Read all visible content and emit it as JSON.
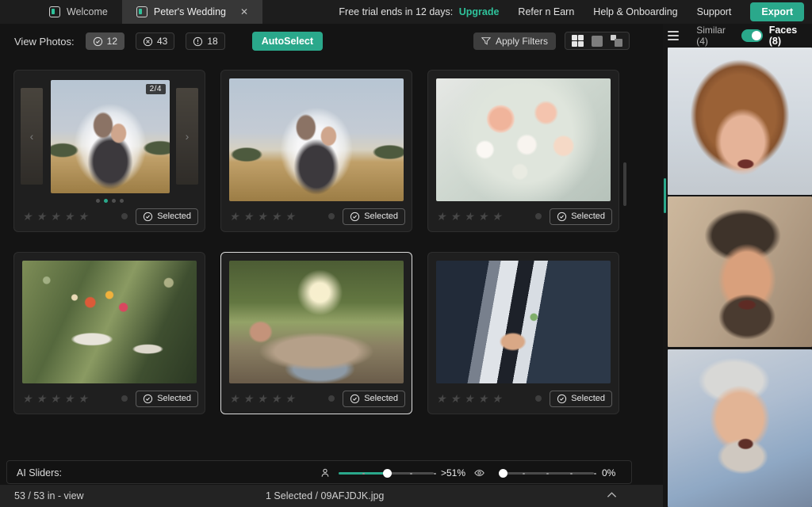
{
  "colors": {
    "accent": "#2aa88b",
    "accent_bright": "#2fc29b"
  },
  "tabbar": {
    "tabs": [
      {
        "label": "Welcome",
        "active": false
      },
      {
        "label": "Peter's Wedding",
        "active": true
      }
    ],
    "trial_text": "Free trial ends in 12 days:",
    "upgrade_label": "Upgrade",
    "links": [
      {
        "label": "Refer n Earn"
      },
      {
        "label": "Help & Onboarding"
      },
      {
        "label": "Support"
      }
    ],
    "export_label": "Export"
  },
  "toolbar": {
    "view_photos_label": "View Photos:",
    "filter_chips": [
      {
        "icon": "check-circle",
        "count": "12",
        "active": true
      },
      {
        "icon": "cross-circle",
        "count": "43",
        "active": false
      },
      {
        "icon": "alert-circle",
        "count": "18",
        "active": false
      }
    ],
    "autoselect_label": "AutoSelect",
    "apply_filters_label": "Apply Filters"
  },
  "grid": {
    "selected_label": "Selected",
    "cards": [
      {
        "photo": "veil-couple-carousel",
        "carousel_badge": "2/4",
        "dots_count": 4,
        "dots_active_index": 1,
        "stars": 0,
        "selected": true
      },
      {
        "photo": "veil-couple-wide",
        "stars": 0,
        "selected": true
      },
      {
        "photo": "rose-bouquet",
        "stars": 0,
        "selected": true
      },
      {
        "photo": "table-setting",
        "stars": 0,
        "selected": true
      },
      {
        "photo": "family-group",
        "focused": true,
        "stars": 0,
        "selected": true
      },
      {
        "photo": "groom-boutonniere",
        "stars": 0,
        "selected": true
      }
    ]
  },
  "sidebar": {
    "similar_label": "Similar (4)",
    "faces_label": "Faces (8)",
    "toggle_state": "faces",
    "faces": [
      {
        "desc": "laughing woman with auburn hair"
      },
      {
        "desc": "laughing bearded man"
      },
      {
        "desc": "laughing older man in blue shirt"
      }
    ]
  },
  "sliders": {
    "label": "AI Sliders:",
    "people_slider": {
      "icon": "person",
      "value_label": ">51%",
      "percent": 51
    },
    "eye_slider": {
      "icon": "eye",
      "value_label": "0%",
      "percent": 0
    }
  },
  "statusbar": {
    "left_text": "53 / 53 in - view",
    "selection_text": "1 Selected / 09AFJDJK.jpg"
  }
}
